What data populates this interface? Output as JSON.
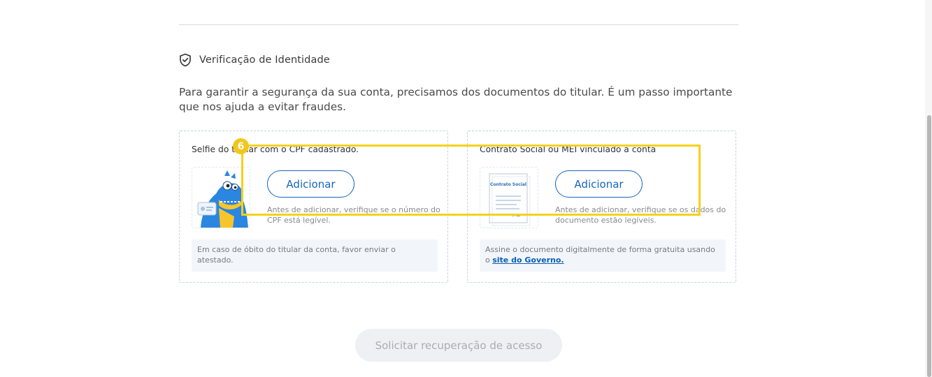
{
  "section": {
    "title": "Verificação de Identidade",
    "icon": "shield-check-icon"
  },
  "intro": "Para garantir a segurança da sua conta, precisamos dos documentos do titular. É um passo importante que nos ajuda a evitar fraudes.",
  "cards": [
    {
      "title": "Selfie do titular com o CPF cadastrado.",
      "button": "Adicionar",
      "hint": "Antes de adicionar, verifique se o número do CPF está legível.",
      "note": "Em caso de óbito do titular da conta, favor enviar o atestado."
    },
    {
      "title": "Contrato Social ou MEI vinculado à conta",
      "doc_title": "Contrato Social",
      "button": "Adicionar",
      "hint": "Antes de adicionar, verifique se os dados do documento estão legíveis.",
      "note_prefix": "Assine o documento digitalmente de forma gratuita usando o",
      "note_link": "site do Governo."
    }
  ],
  "annotation": {
    "number": "6"
  },
  "submit": "Solicitar recuperação de acesso",
  "colors": {
    "primary": "#1565c0",
    "highlight": "#f3d21a",
    "note_bg": "#f2f6fb"
  }
}
